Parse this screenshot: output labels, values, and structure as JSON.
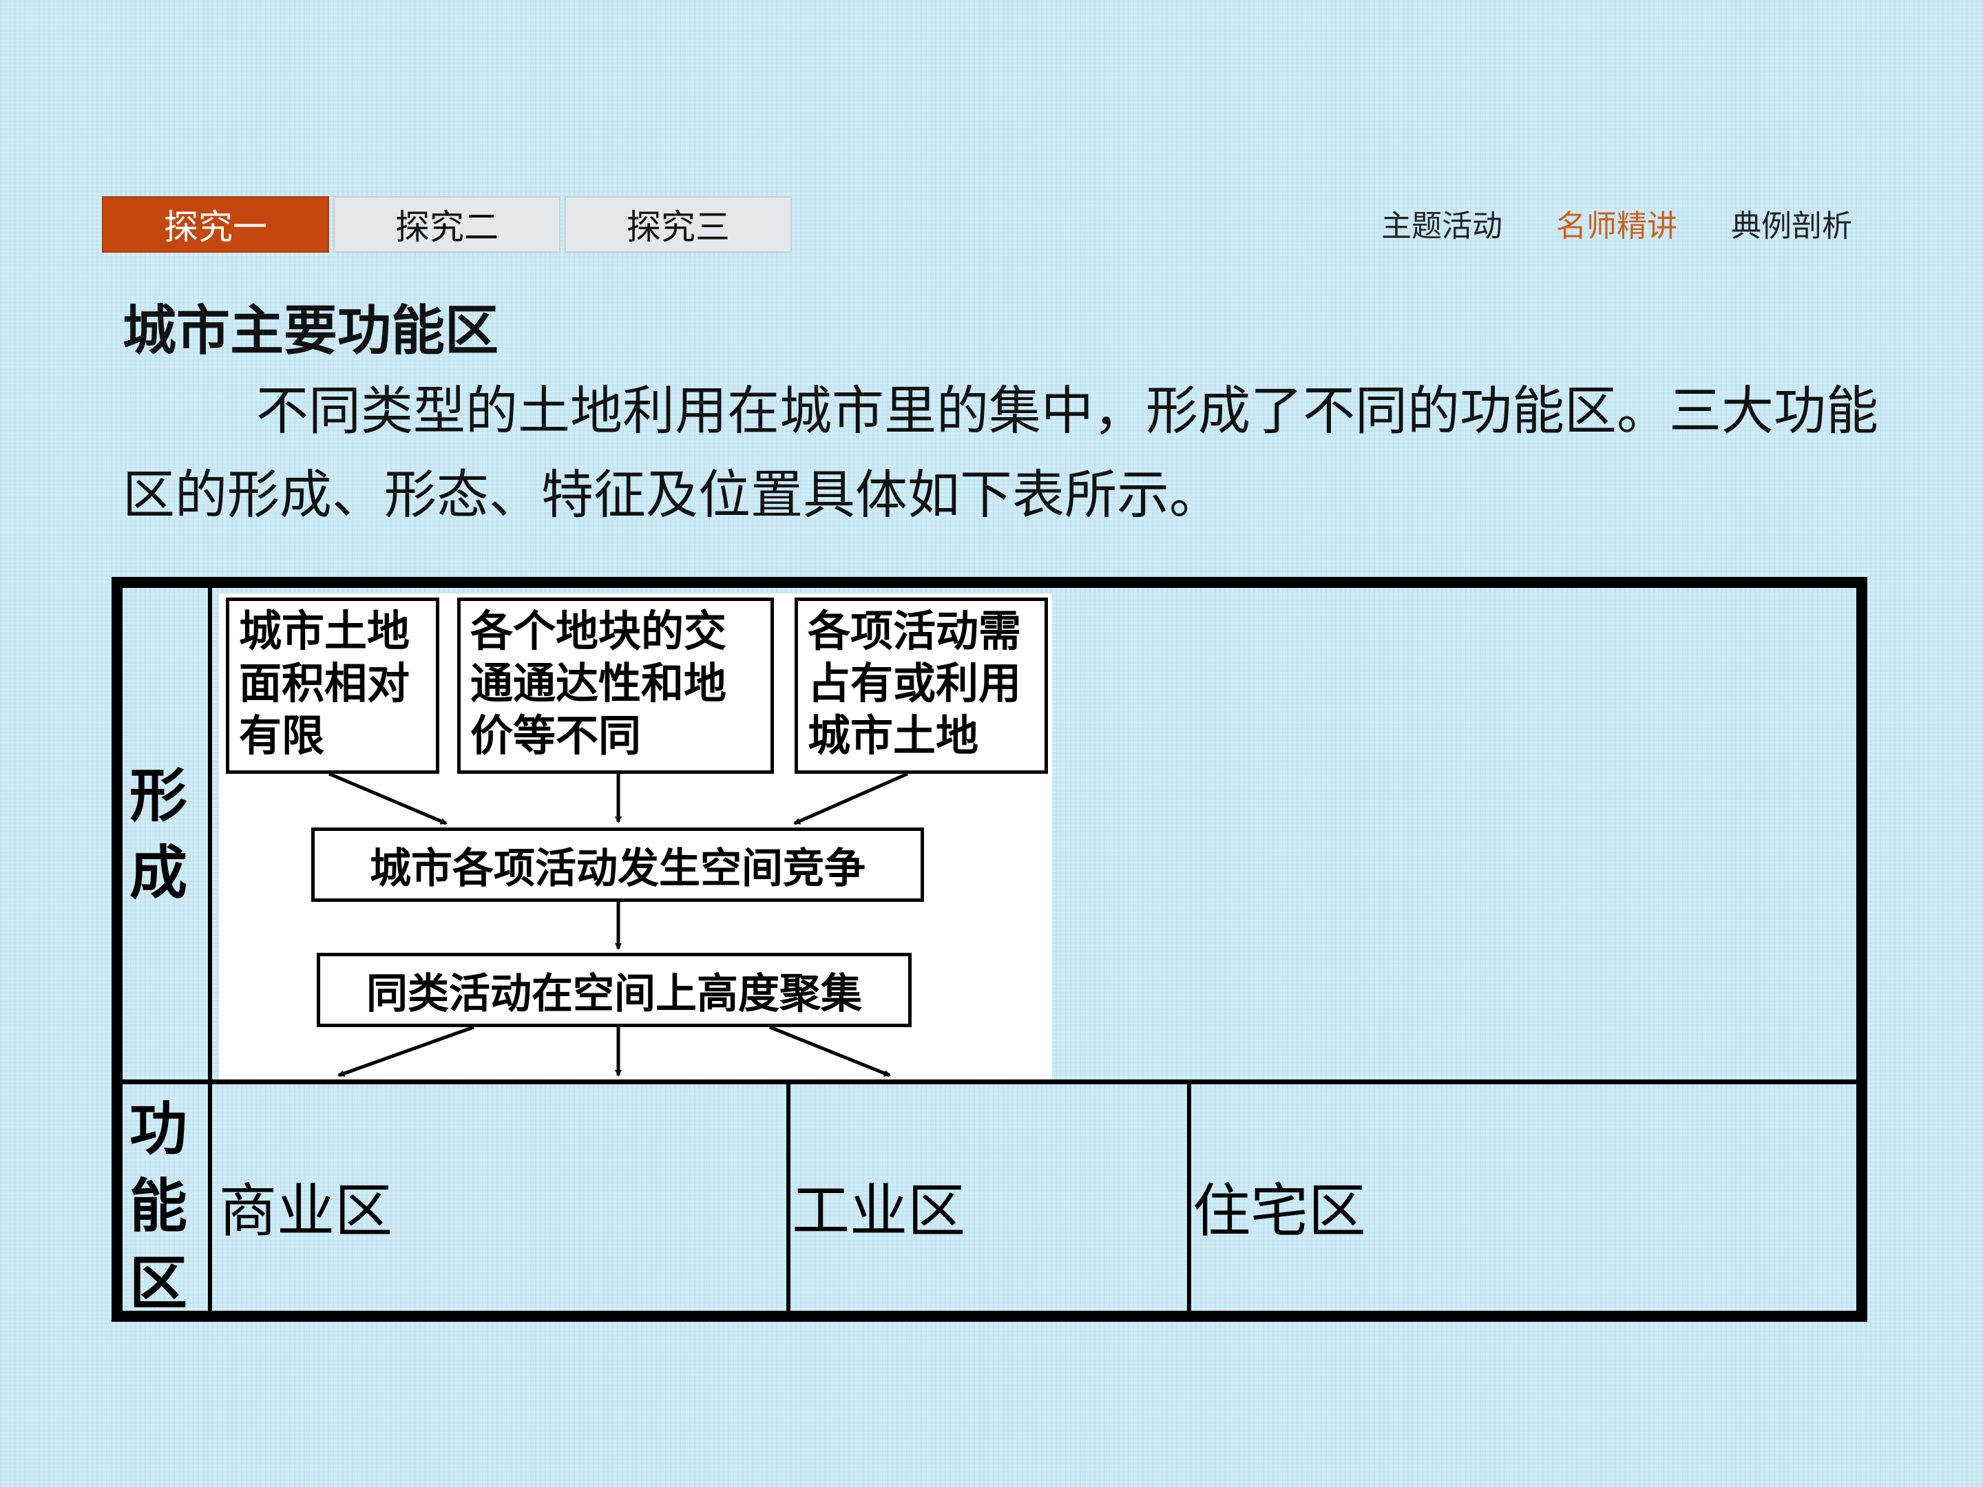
{
  "tabs": [
    {
      "label": "探究一",
      "active": true
    },
    {
      "label": "探究二",
      "active": false
    },
    {
      "label": "探究三",
      "active": false
    }
  ],
  "nav": [
    {
      "label": "主题活动",
      "active": false
    },
    {
      "label": "名师精讲",
      "active": true
    },
    {
      "label": "典例剖析",
      "active": false
    }
  ],
  "heading": "城市主要功能区",
  "paragraph": "不同类型的土地利用在城市里的集中，形成了不同的功能区。三大功能区的形成、形态、特征及位置具体如下表所示。",
  "table": {
    "row1_label": "形成",
    "row2_label": "功能区",
    "flow": {
      "box1": "城市土地面积相对有限",
      "box2": "各个地块的交通通达性和地价等不同",
      "box3": "各项活动需占有或利用城市土地",
      "box4": "城市各项活动发生空间竞争",
      "box5": "同类活动在空间上高度聚集"
    },
    "zones": [
      "商业区",
      "工业区",
      "住宅区"
    ]
  },
  "colors": {
    "accent": "#c4470e",
    "nav_active": "#d0601a",
    "background": "#c9e9f5"
  }
}
